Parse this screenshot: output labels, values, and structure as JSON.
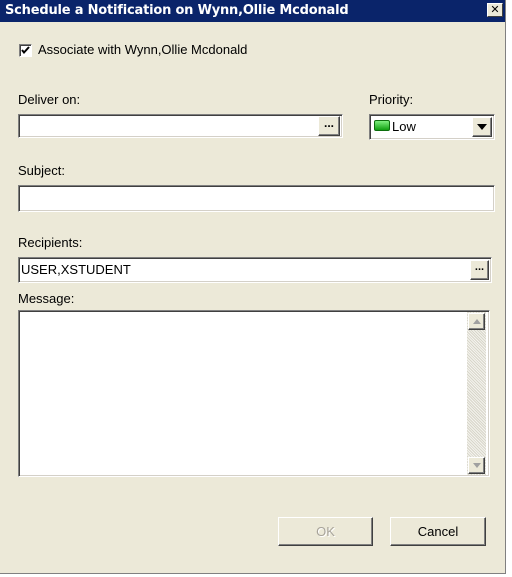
{
  "window": {
    "title": "Schedule a Notification on Wynn,Ollie Mcdonald",
    "close_glyph": "✕"
  },
  "associate": {
    "label": "Associate with Wynn,Ollie Mcdonald",
    "checked": true
  },
  "deliver_on": {
    "label": "Deliver on:",
    "value": "",
    "browse_label": "..."
  },
  "priority": {
    "label": "Priority:",
    "value": "Low",
    "color": "#22c022",
    "icon": "green-priority-swatch"
  },
  "subject": {
    "label": "Subject:",
    "value": ""
  },
  "recipients": {
    "label": "Recipients:",
    "value": "USER,XSTUDENT",
    "browse_label": "..."
  },
  "message": {
    "label": "Message:",
    "value": ""
  },
  "buttons": {
    "ok": "OK",
    "cancel": "Cancel"
  }
}
